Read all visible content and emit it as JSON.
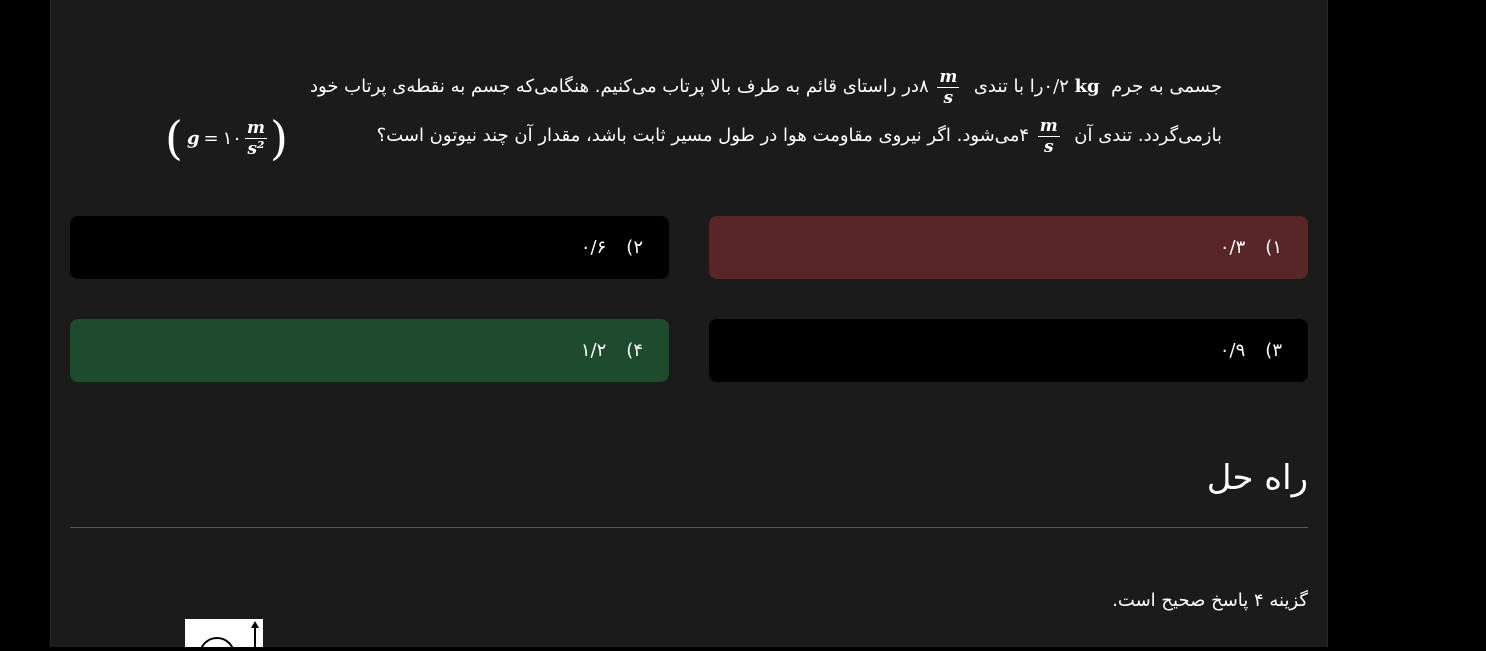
{
  "question": {
    "line1_part1": "جسمی به جرم",
    "mass_value": "۰/۲",
    "mass_unit": "kg",
    "line1_part2": "را با تندی",
    "speed1_value": "۸",
    "line1_part3": "در راستای قائم به طرف بالا پرتاب می‌کنیم. هنگامی‌که جسم به نقطه‌ی پرتاب خود",
    "line2_part1": "بازمی‌گردد. تندی آن",
    "speed2_value": "۴",
    "line2_part2": "می‌شود. اگر نیروی مقاومت هوا در طول مسیر ثابت باشد، مقدار آن چند نیوتون است؟",
    "unit_num": "m",
    "unit_den": "s",
    "g_symbol": "g",
    "g_equals": "=",
    "g_value": "۱۰",
    "g_unit_den": "s²"
  },
  "options": [
    {
      "label": "۱)",
      "value": "۰/۳",
      "state": "selected-wrong",
      "color": "#582626"
    },
    {
      "label": "۲)",
      "value": "۰/۶",
      "state": "neutral",
      "color": "#000000"
    },
    {
      "label": "۳)",
      "value": "۰/۹",
      "state": "neutral",
      "color": "#000000"
    },
    {
      "label": "۴)",
      "value": "۱/۲",
      "state": "correct",
      "color": "#1e4a2e"
    }
  ],
  "solution": {
    "title": "راه حل",
    "answer_text": "گزینه ۴ پاسخ صحیح است."
  }
}
